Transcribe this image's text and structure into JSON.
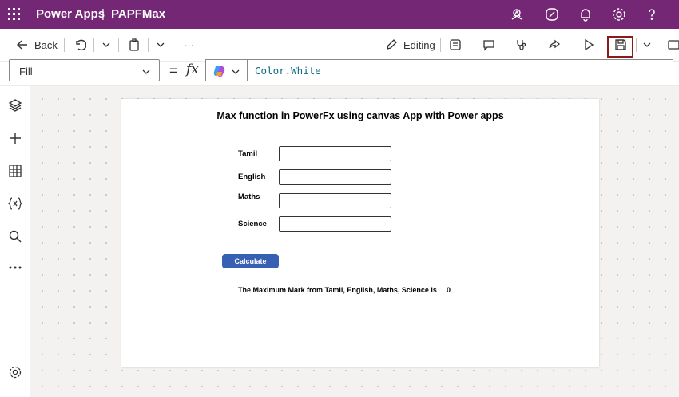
{
  "header": {
    "app_name": "Power Apps",
    "separator": "|",
    "document_name": "PAPFMax",
    "bg_color": "#742774"
  },
  "toolbar": {
    "back_label": "Back",
    "more_label": "···",
    "editing_label": "Editing"
  },
  "formula_bar": {
    "property": "Fill",
    "equals": "=",
    "fx": "fx",
    "formula": "Color.White"
  },
  "screen": {
    "heading": "Max function in  PowerFx using canvas App with Power apps",
    "fields": [
      {
        "label": "Tamil",
        "value": ""
      },
      {
        "label": "English",
        "value": ""
      },
      {
        "label": "Maths",
        "value": ""
      },
      {
        "label": "Science",
        "value": ""
      }
    ],
    "calculate_label": "Calculate",
    "result_text": "The Maximum Mark from Tamil, English, Maths, Science is",
    "result_value": "0",
    "button_color": "#3860b2"
  }
}
